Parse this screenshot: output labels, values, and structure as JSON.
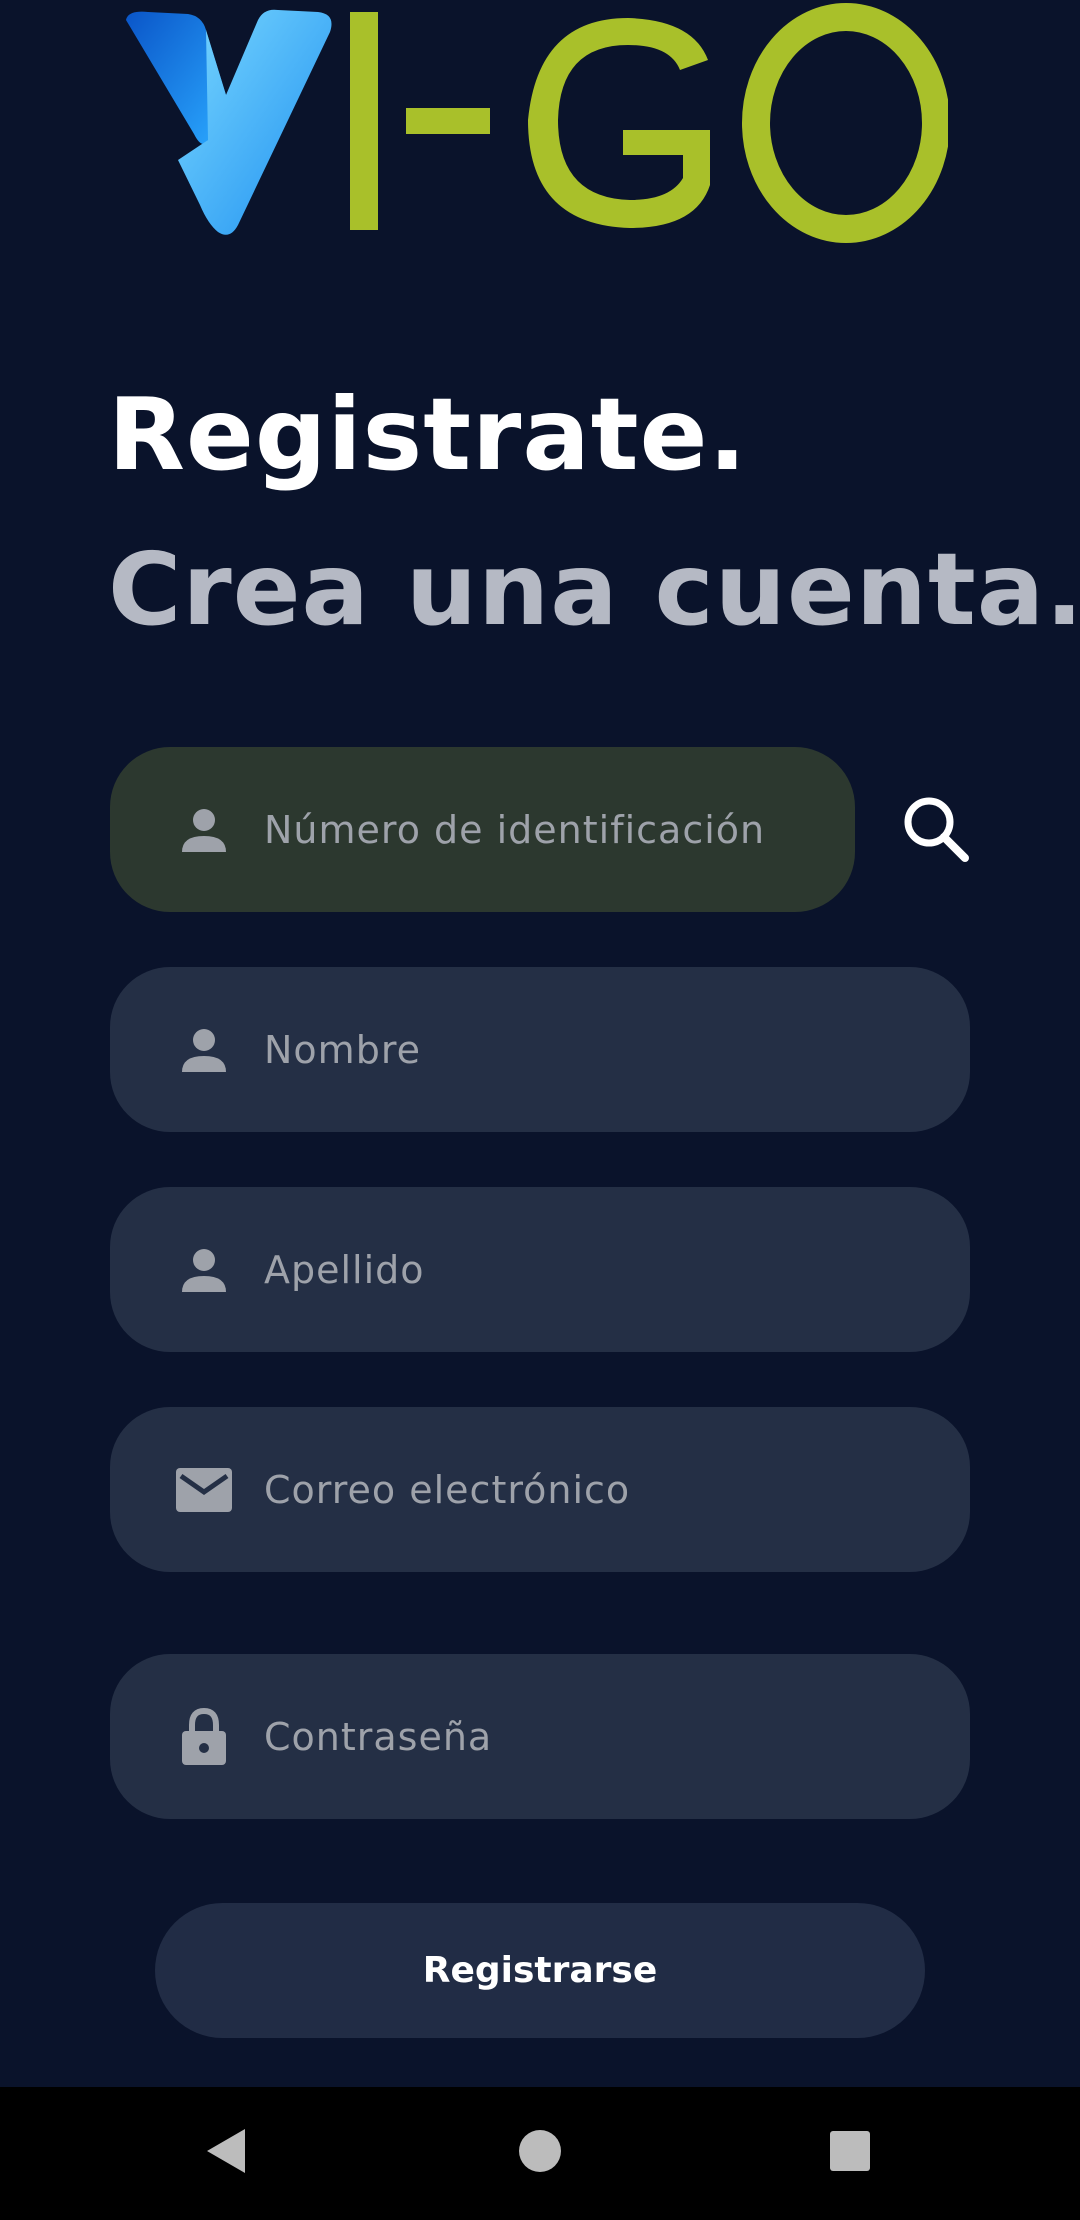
{
  "logo": {
    "text": "VI-GO",
    "colors": {
      "v_primary": "#0b7de8",
      "v_secondary": "#4cc4ff",
      "letters": "#a9c02a"
    }
  },
  "header": {
    "title": "Registrate.",
    "subtitle": "Crea una cuenta."
  },
  "form": {
    "id_number": {
      "placeholder": "Número de identificación",
      "icon": "person-icon"
    },
    "first_name": {
      "placeholder": "Nombre",
      "icon": "person-icon"
    },
    "last_name": {
      "placeholder": "Apellido",
      "icon": "person-icon"
    },
    "email": {
      "placeholder": "Correo electrónico",
      "icon": "mail-icon"
    },
    "password": {
      "placeholder": "Contraseña",
      "icon": "lock-icon"
    },
    "search_icon": "search-icon",
    "submit_label": "Registrarse"
  },
  "navbar": {
    "back_icon": "back-triangle-icon",
    "home_icon": "home-circle-icon",
    "recents_icon": "recents-square-icon"
  },
  "colors": {
    "background": "#0a132b",
    "field": "#242f45",
    "field_active": "#2c382f",
    "button": "#212c45",
    "placeholder_text": "#9ea2aa",
    "subtitle_text": "#b5b9c4"
  }
}
